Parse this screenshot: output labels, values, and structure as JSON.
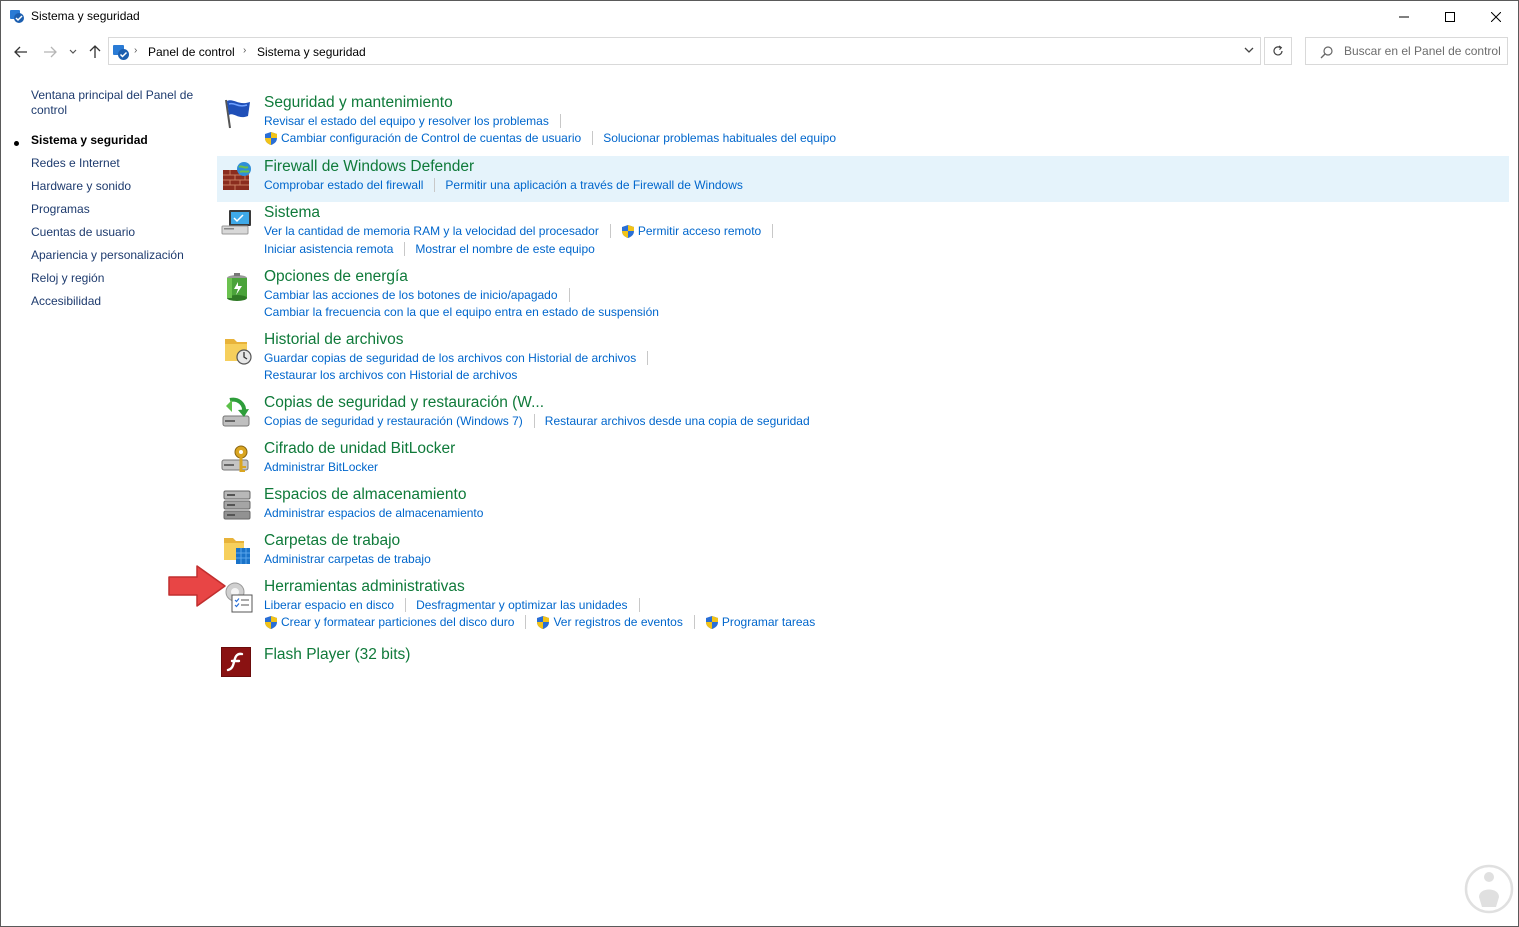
{
  "window": {
    "title": "Sistema y seguridad"
  },
  "address": {
    "crumbs": [
      "Panel de control",
      "Sistema y seguridad"
    ]
  },
  "search": {
    "placeholder": "Buscar en el Panel de control"
  },
  "sidebar": {
    "items": [
      {
        "label": "Ventana principal del Panel de control",
        "active": false
      },
      {
        "label": "Sistema y seguridad",
        "active": true
      },
      {
        "label": "Redes e Internet",
        "active": false
      },
      {
        "label": "Hardware y sonido",
        "active": false
      },
      {
        "label": "Programas",
        "active": false
      },
      {
        "label": "Cuentas de usuario",
        "active": false
      },
      {
        "label": "Apariencia y personalización",
        "active": false
      },
      {
        "label": "Reloj y región",
        "active": false
      },
      {
        "label": "Accesibilidad",
        "active": false
      }
    ]
  },
  "categories": [
    {
      "title": "Seguridad y mantenimiento",
      "icon": "flag-icon",
      "rows": [
        [
          {
            "label": "Revisar el estado del equipo y resolver los problemas"
          }
        ],
        [
          {
            "label": "Cambiar configuración de Control de cuentas de usuario",
            "shield": true
          },
          {
            "label": "Solucionar problemas habituales del equipo"
          }
        ]
      ]
    },
    {
      "title": "Firewall de Windows Defender",
      "icon": "firewall-icon",
      "rows": [
        [
          {
            "label": "Comprobar estado del firewall"
          },
          {
            "label": "Permitir una aplicación a través de Firewall de Windows"
          }
        ]
      ]
    },
    {
      "title": "Sistema",
      "icon": "computer-icon",
      "rows": [
        [
          {
            "label": "Ver la cantidad de memoria RAM y la velocidad del procesador"
          },
          {
            "label": "Permitir acceso remoto",
            "shield": true
          }
        ],
        [
          {
            "label": "Iniciar asistencia remota"
          },
          {
            "label": "Mostrar el nombre de este equipo"
          }
        ]
      ]
    },
    {
      "title": "Opciones de energía",
      "icon": "battery-icon",
      "rows": [
        [
          {
            "label": "Cambiar las acciones de los botones de inicio/apagado"
          }
        ],
        [
          {
            "label": "Cambiar la frecuencia con la que el equipo entra en estado de suspensión"
          }
        ]
      ]
    },
    {
      "title": "Historial de archivos",
      "icon": "file-history-icon",
      "rows": [
        [
          {
            "label": "Guardar copias de seguridad de los archivos con Historial de archivos"
          }
        ],
        [
          {
            "label": "Restaurar los archivos con Historial de archivos"
          }
        ]
      ]
    },
    {
      "title": "Copias de seguridad y restauración (W...",
      "icon": "backup-icon",
      "rows": [
        [
          {
            "label": "Copias de seguridad y restauración (Windows 7)"
          },
          {
            "label": "Restaurar archivos desde una copia de seguridad"
          }
        ]
      ]
    },
    {
      "title": "Cifrado de unidad BitLocker",
      "icon": "bitlocker-icon",
      "rows": [
        [
          {
            "label": "Administrar BitLocker"
          }
        ]
      ]
    },
    {
      "title": "Espacios de almacenamiento",
      "icon": "storage-spaces-icon",
      "rows": [
        [
          {
            "label": "Administrar espacios de almacenamiento"
          }
        ]
      ]
    },
    {
      "title": "Carpetas de trabajo",
      "icon": "work-folders-icon",
      "rows": [
        [
          {
            "label": "Administrar carpetas de trabajo"
          }
        ]
      ]
    },
    {
      "title": "Herramientas administrativas",
      "icon": "admin-tools-icon",
      "rows": [
        [
          {
            "label": "Liberar espacio en disco"
          },
          {
            "label": "Desfragmentar y optimizar las unidades"
          }
        ],
        [
          {
            "label": "Crear y formatear particiones del disco duro",
            "shield": true
          },
          {
            "label": "Ver registros de eventos",
            "shield": true
          },
          {
            "label": "Programar tareas",
            "shield": true
          }
        ]
      ]
    },
    {
      "title": "Flash Player (32 bits)",
      "icon": "flash-icon",
      "rows": []
    }
  ],
  "colors": {
    "title_green": "#0f7a3a",
    "link_blue": "#0066cc",
    "hover_bg": "#e5f3fb",
    "annotation_arrow": "#e84545"
  }
}
